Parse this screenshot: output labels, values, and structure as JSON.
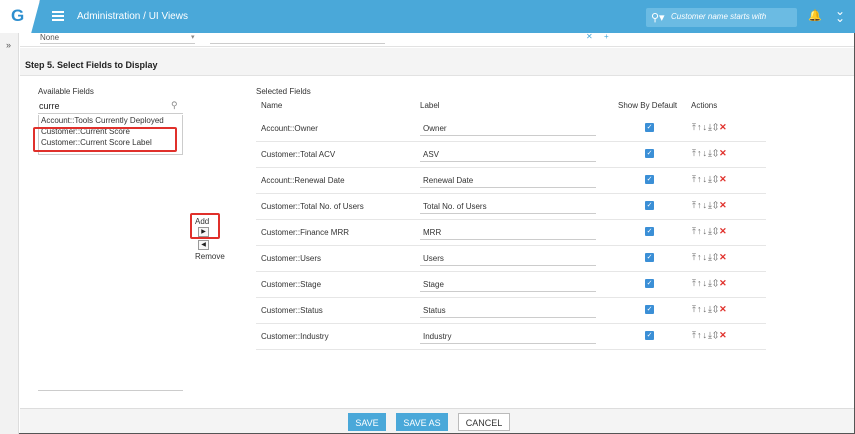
{
  "app": {
    "logo": "G",
    "breadcrumb": "Administration / UI Views"
  },
  "search": {
    "placeholder": "Customer name starts with"
  },
  "previous_step": {
    "none_label": "None"
  },
  "step": {
    "title": "Step 5. Select Fields to Display"
  },
  "available": {
    "title": "Available Fields",
    "query": "curre",
    "items": [
      "Account::Tools Currently Deployed",
      "Customer::Current Score",
      "Customer::Current Score Label"
    ]
  },
  "transfer": {
    "add_label": "Add",
    "remove_label": "Remove"
  },
  "selected": {
    "title": "Selected Fields",
    "headers": {
      "name": "Name",
      "label": "Label",
      "show": "Show By Default",
      "actions": "Actions"
    },
    "rows": [
      {
        "name": "Account::Owner",
        "label": "Owner",
        "show": true
      },
      {
        "name": "Customer::Total ACV",
        "label": "ASV",
        "show": true
      },
      {
        "name": "Account::Renewal Date",
        "label": "Renewal Date",
        "show": true
      },
      {
        "name": "Customer::Total No. of Users",
        "label": "Total No. of Users",
        "show": true
      },
      {
        "name": "Customer::Finance MRR",
        "label": "MRR",
        "show": true
      },
      {
        "name": "Customer::Users",
        "label": "Users",
        "show": true
      },
      {
        "name": "Customer::Stage",
        "label": "Stage",
        "show": true
      },
      {
        "name": "Customer::Status",
        "label": "Status",
        "show": true
      },
      {
        "name": "Customer::Industry",
        "label": "Industry",
        "show": true
      }
    ]
  },
  "footer": {
    "save": "SAVE",
    "save_as": "SAVE AS",
    "cancel": "CANCEL"
  },
  "colors": {
    "accent": "#4aa8d9",
    "highlight": "#e0302b",
    "checkbox": "#3b8fd6"
  }
}
